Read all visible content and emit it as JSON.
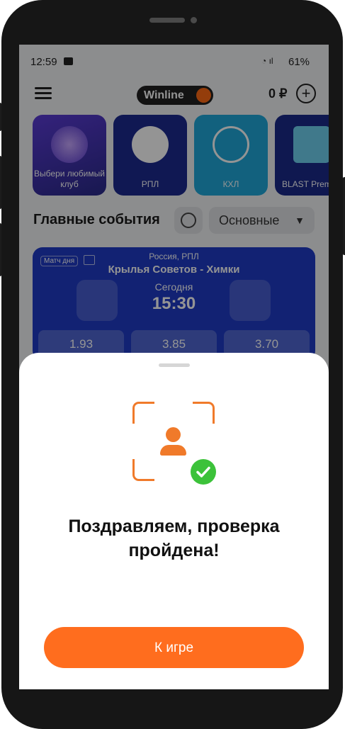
{
  "status_bar": {
    "time": "12:59",
    "battery": "61%"
  },
  "header": {
    "logo_text": "Winline",
    "balance": "0 ₽"
  },
  "categories": [
    {
      "label": "Выбери любимый клуб"
    },
    {
      "label": "РПЛ"
    },
    {
      "label": "КХЛ"
    },
    {
      "label": "BLAST Prem"
    }
  ],
  "section": {
    "title": "Главные события",
    "filter": "Основные"
  },
  "match": {
    "tag": "Матч дня",
    "league": "Россия, РПЛ",
    "teams": "Крылья Советов - Химки",
    "day": "Сегодня",
    "time": "15:30",
    "odds": [
      "1.93",
      "3.85",
      "3.70"
    ]
  },
  "sheet": {
    "title": "Поздравляем, проверка пройдена!",
    "button": "К игре"
  },
  "colors": {
    "accent": "#ff6d1e",
    "success": "#3cc23a",
    "match_bg": "#1f3bc7"
  }
}
